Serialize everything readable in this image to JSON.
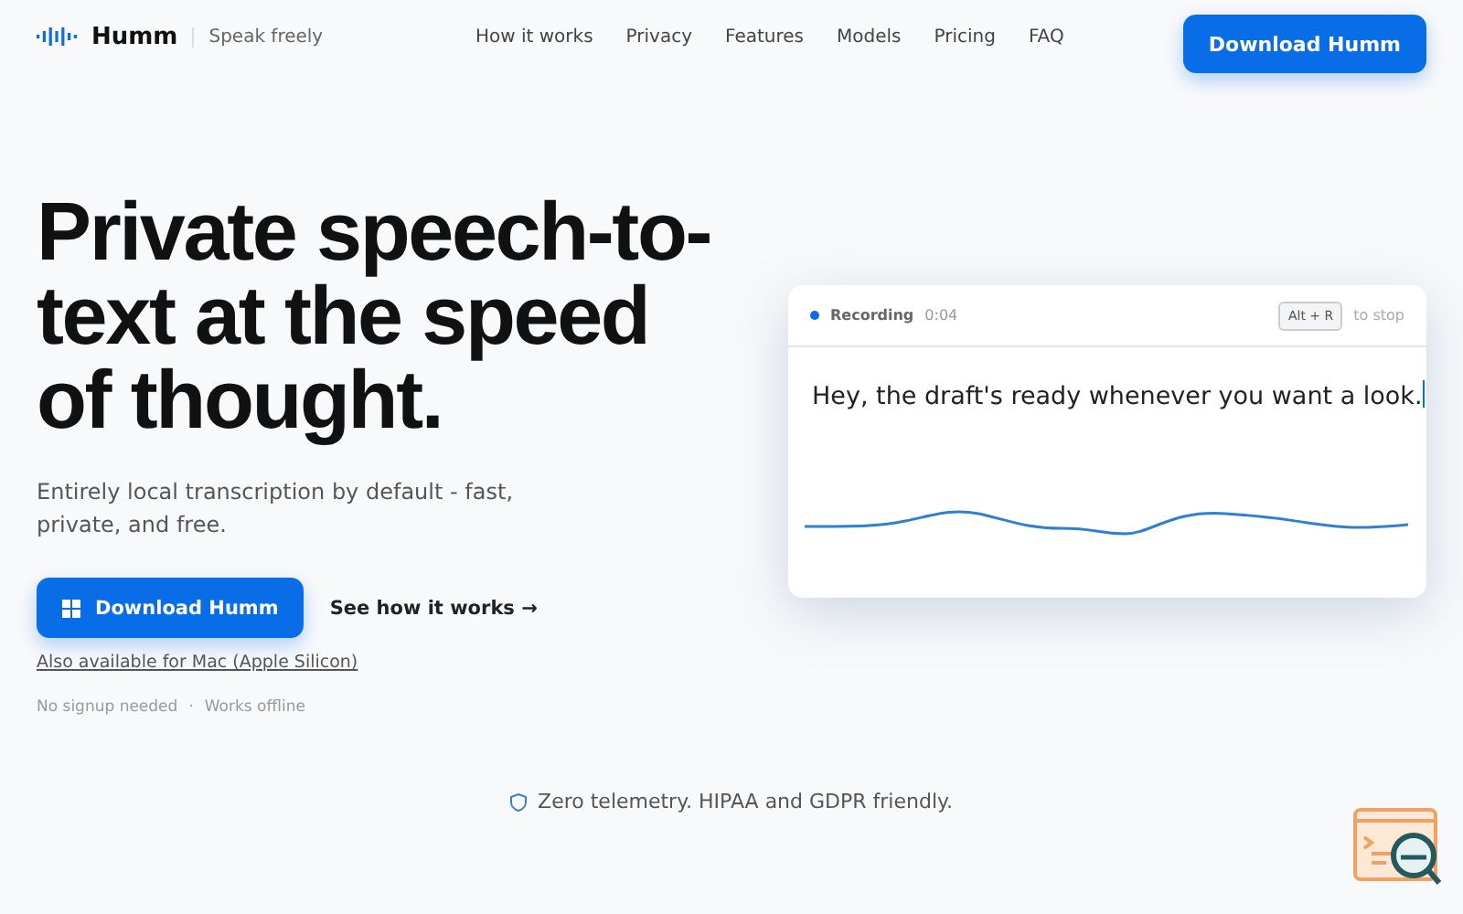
{
  "header": {
    "brand": "Humm",
    "tagline": "Speak freely",
    "nav": [
      {
        "label": "How it works"
      },
      {
        "label": "Privacy"
      },
      {
        "label": "Features"
      },
      {
        "label": "Models"
      },
      {
        "label": "Pricing"
      },
      {
        "label": "FAQ"
      }
    ],
    "cta": "Download Humm"
  },
  "hero": {
    "title_lines": [
      "Private speech-to-",
      "text at the speed",
      "of thought."
    ],
    "subtitle": "Entirely local transcription by default - fast, private, and free.",
    "primary": "Download Humm",
    "secondary": "See how it works",
    "secondary_arrow": "→",
    "mac_link": "Also available for Mac (Apple Silicon)",
    "notes": [
      "No signup needed",
      "Works offline"
    ],
    "separator": "·"
  },
  "demo": {
    "status": "Recording",
    "time": "0:04",
    "shortcut": "Alt + R",
    "shortcut_hint": "to stop",
    "transcript": "Hey, the draft's ready whenever you want a look."
  },
  "footer_note": "Zero telemetry. HIPAA and GDPR friendly."
}
